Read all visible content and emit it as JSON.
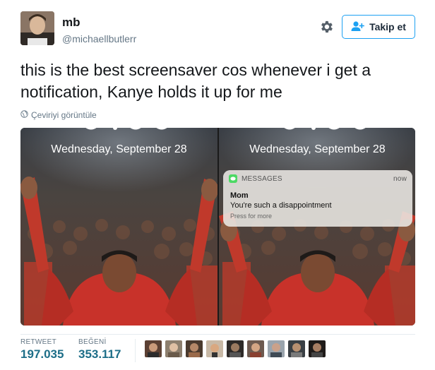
{
  "user": {
    "name": "mb",
    "handle": "@michaellbutlerr"
  },
  "header": {
    "settings_icon": "gear-icon",
    "follow_label": "Takip et",
    "follow_icon": "add-user-icon",
    "accent": "#1da1f2"
  },
  "tweet": {
    "text": "this is the best screensaver cos whenever i get a notification, Kanye holds it up for me",
    "translate_label": "Çeviriyi görüntüle",
    "translate_icon": "globe-icon"
  },
  "media": {
    "left": {
      "date": "Wednesday, September 28"
    },
    "right": {
      "date": "Wednesday, September 28",
      "notification": {
        "app": "MESSAGES",
        "time": "now",
        "from": "Mom",
        "message": "You're such a disappointment",
        "hint": "Press for more"
      }
    }
  },
  "stats": {
    "retweets_label": "RETWEET",
    "retweets_value": "197.035",
    "likes_label": "BEĞENİ",
    "likes_value": "353.117",
    "value_color": "#1d6e88"
  }
}
